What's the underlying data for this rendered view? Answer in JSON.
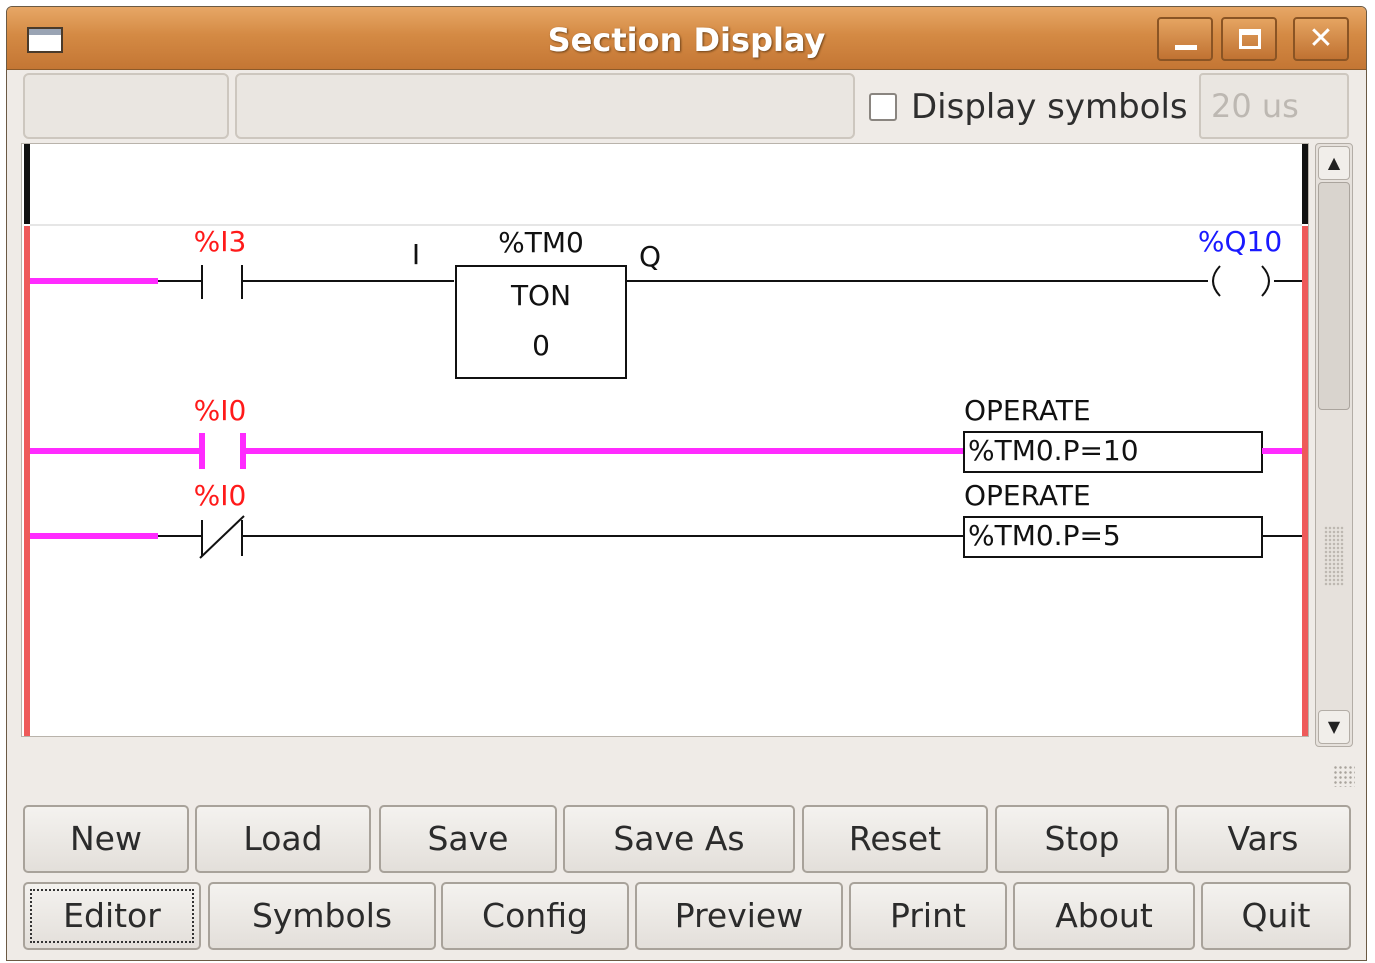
{
  "window": {
    "title": "Section Display"
  },
  "titlebar_buttons": {
    "minimize": "minimize-icon",
    "maximize": "maximize-icon",
    "close": "close-icon"
  },
  "status": {
    "left_text": "",
    "middle_text": ""
  },
  "display_symbols": {
    "label": "Display symbols",
    "checked": false
  },
  "cycle_time": {
    "value": "20 us"
  },
  "ladder": {
    "rung1": {
      "contact_var": "%I3",
      "timer_name": "%TM0",
      "timer_type": "TON",
      "timer_value": "0",
      "timer_input": "I",
      "timer_output": "Q",
      "coil_var": "%Q10"
    },
    "rung2": {
      "contact_var": "%I0",
      "operate_label": "OPERATE",
      "operate_expr": "%TM0.P=10"
    },
    "rung3": {
      "contact_var": "%I0",
      "operate_label": "OPERATE",
      "operate_expr": "%TM0.P=5"
    },
    "colors": {
      "active_wire": "#ff2bff",
      "rail": "#ee5a5a",
      "contact_label": "#ff1a1a",
      "coil_label": "#1a1aff"
    }
  },
  "buttons_row1": [
    "New",
    "Load",
    "Save",
    "Save As",
    "Reset",
    "Stop",
    "Vars"
  ],
  "buttons_row2": [
    "Editor",
    "Symbols",
    "Config",
    "Preview",
    "Print",
    "About",
    "Quit"
  ]
}
